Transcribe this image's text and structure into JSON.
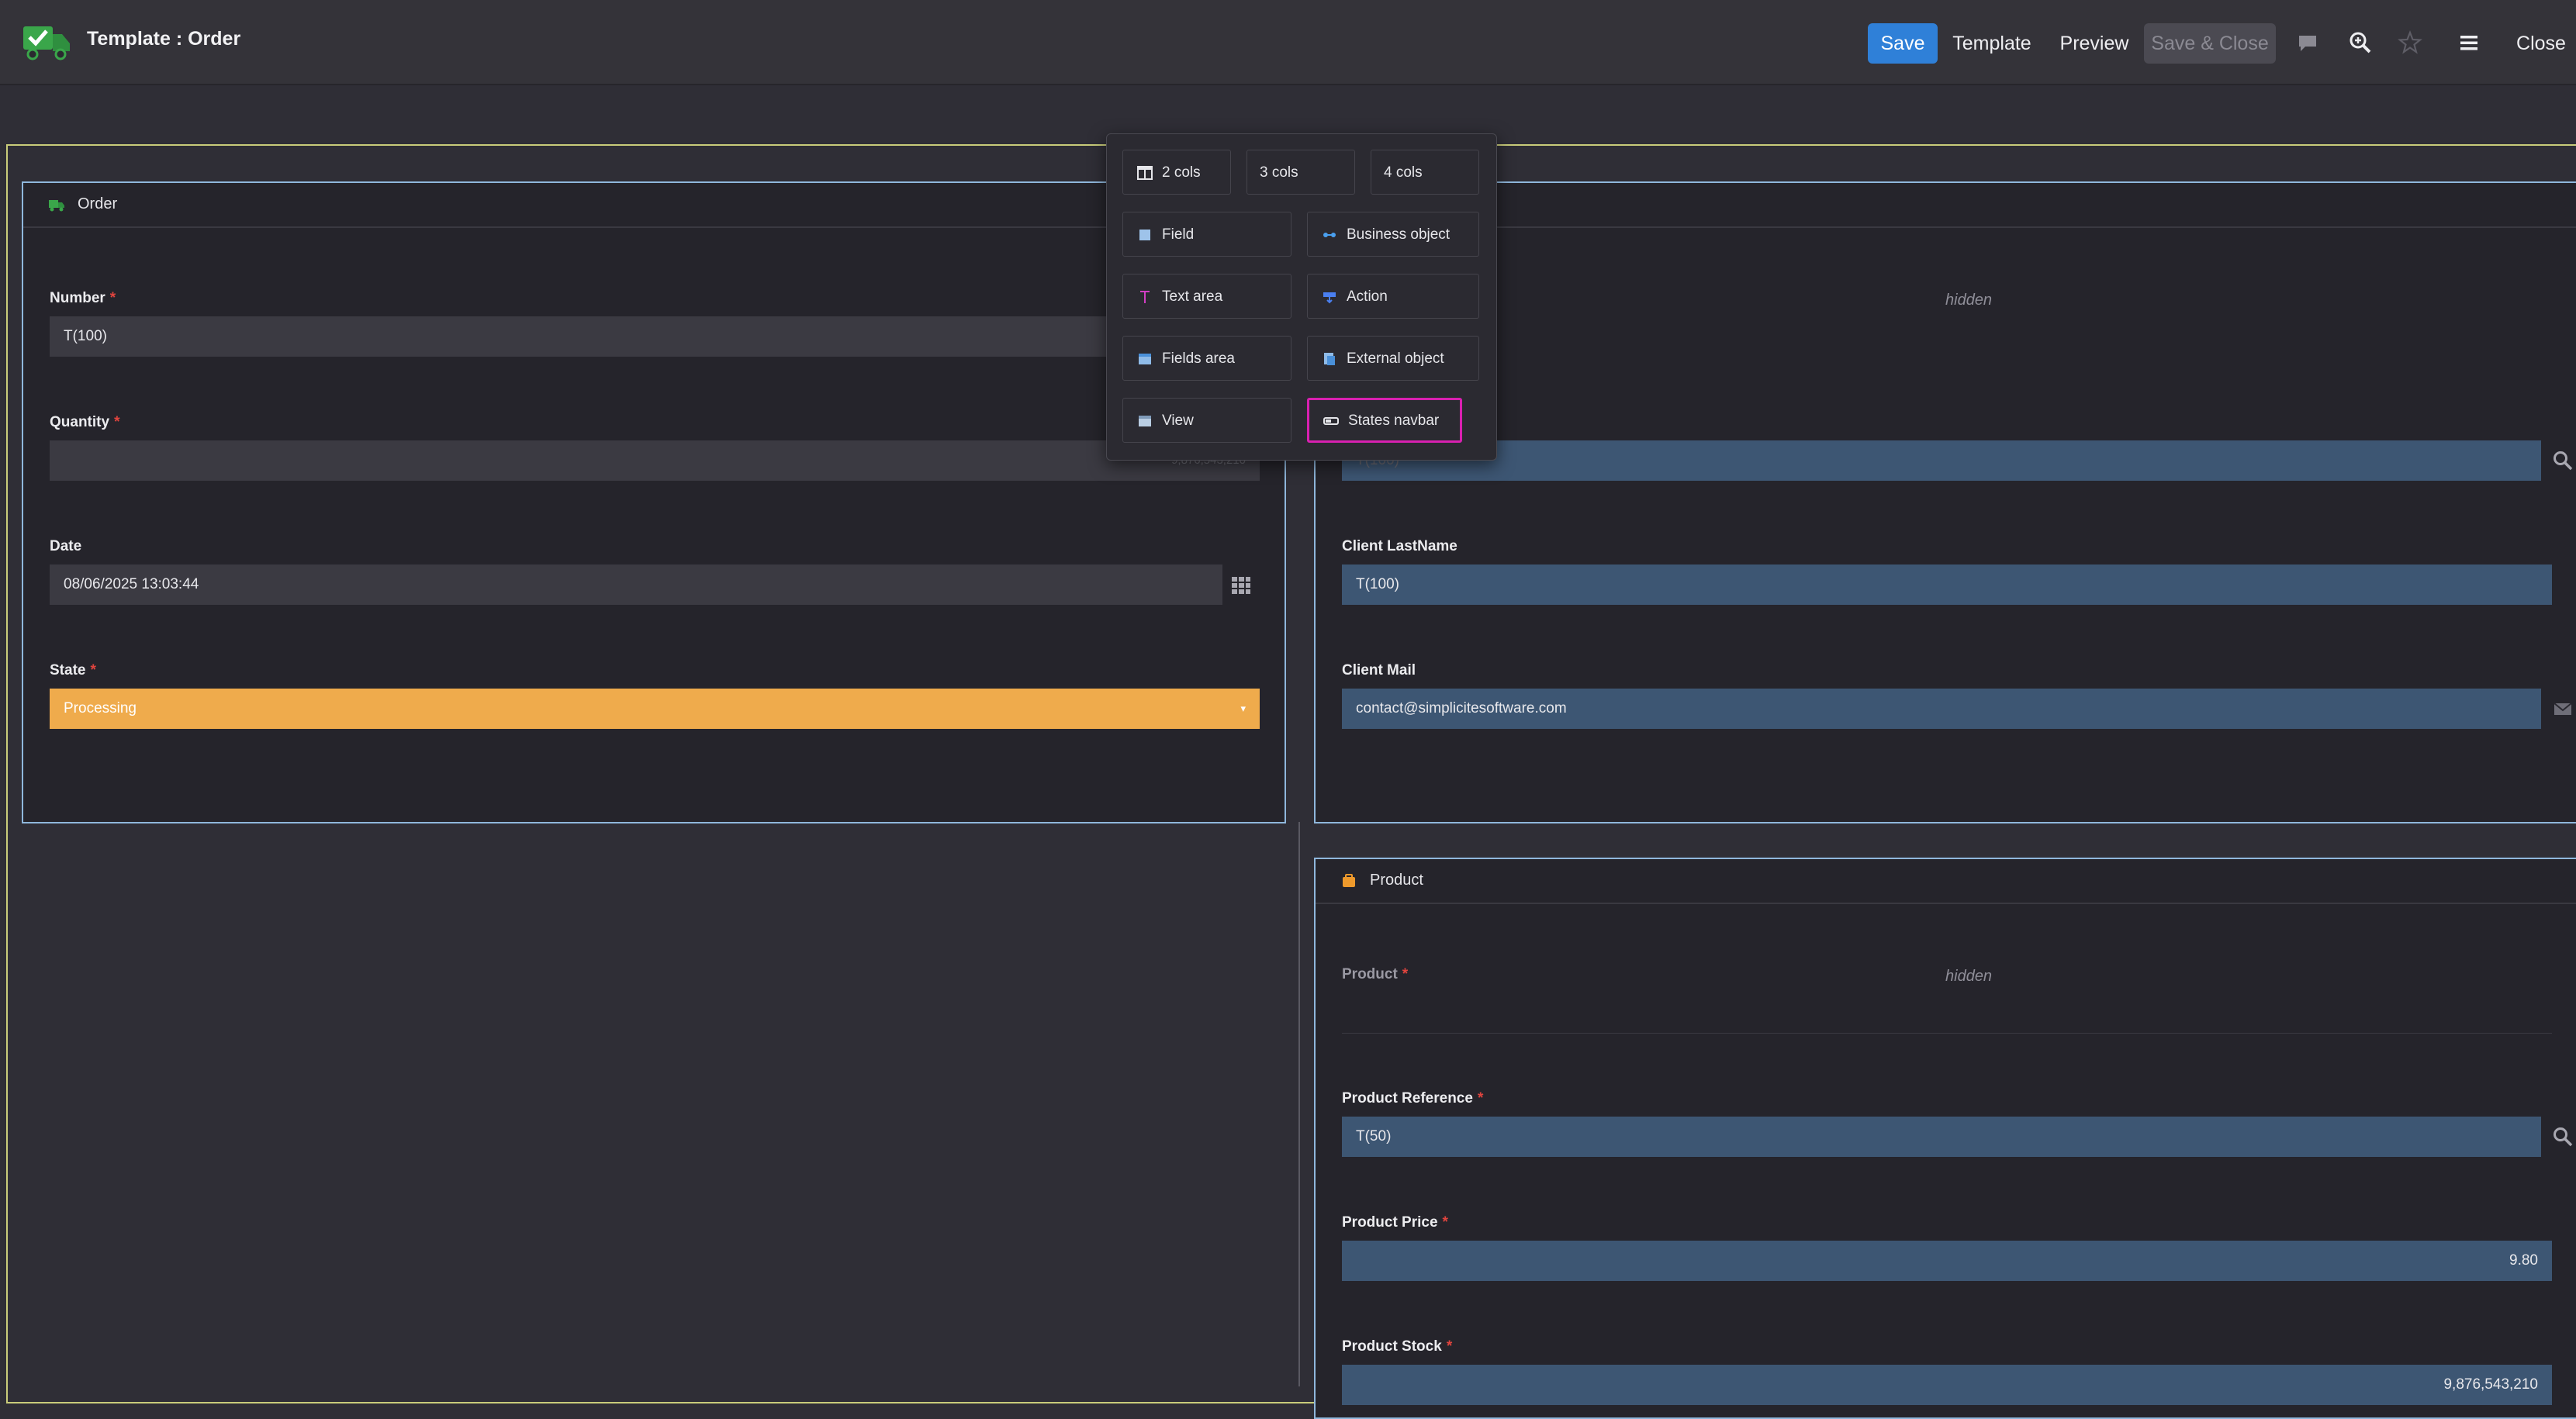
{
  "header": {
    "title": "Template : Order",
    "buttons": {
      "save": "Save",
      "template": "Template",
      "preview": "Preview",
      "save_close": "Save & Close",
      "close": "Close"
    },
    "icons": [
      "app-logo-icon",
      "comment-icon",
      "zoom-icon",
      "star-icon",
      "menu-icon"
    ]
  },
  "order_panel": {
    "title": "Order",
    "number": {
      "label": "Number",
      "value": "T(100)"
    },
    "quantity": {
      "label": "Quantity",
      "value": "9,876,543,210"
    },
    "date": {
      "label": "Date",
      "value": "08/06/2025 13:03:44"
    },
    "state": {
      "label": "State",
      "value": "Processing"
    }
  },
  "client_panel": {
    "hidden_text": "hidden",
    "client_field_value": "T(100)",
    "lastname": {
      "label": "Client LastName",
      "value": "T(100)"
    },
    "mail": {
      "label": "Client Mail",
      "value": "contact@simplicitesoftware.com"
    }
  },
  "product_panel": {
    "title": "Product",
    "product": {
      "label": "Product",
      "hidden_text": "hidden"
    },
    "reference": {
      "label": "Product Reference",
      "value": "T(50)"
    },
    "price": {
      "label": "Product Price",
      "value": "9.80"
    },
    "stock": {
      "label": "Product Stock",
      "value": "9,876,543,210"
    }
  },
  "popover": {
    "cols": [
      "2 cols",
      "3 cols",
      "4 cols"
    ],
    "items": {
      "field": "Field",
      "business_object": "Business object",
      "text_area": "Text area",
      "action": "Action",
      "fields_area": "Fields area",
      "external_object": "External object",
      "view": "View",
      "states_navbar": "States navbar"
    }
  },
  "colors": {
    "accent": "#2f80d8",
    "state_processing": "#efab4c",
    "highlight": "#d820b0",
    "required": "#e0443e"
  }
}
